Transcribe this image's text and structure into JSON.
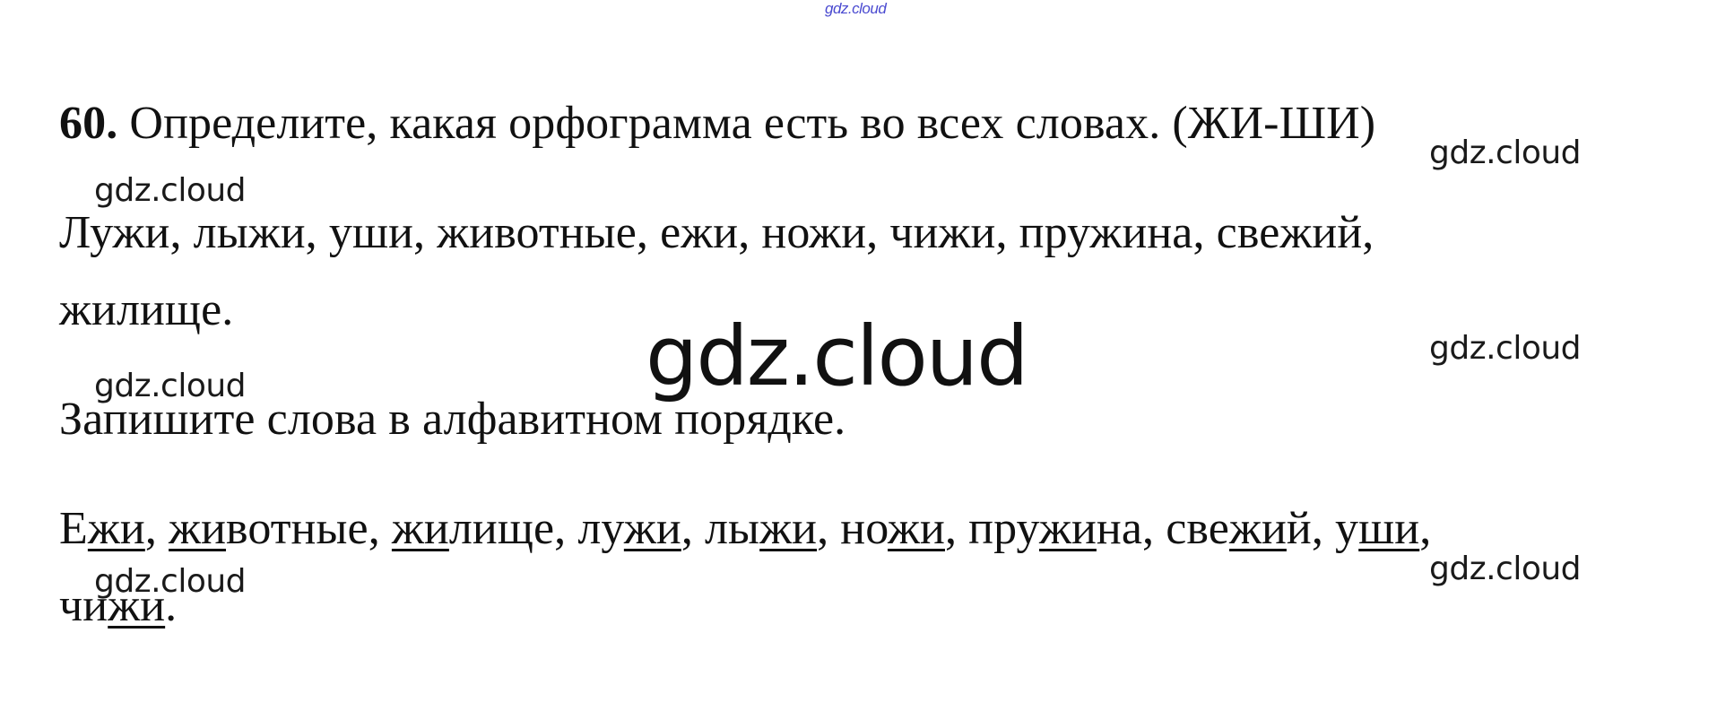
{
  "watermarks": {
    "top": "gdz.cloud",
    "big": "gdz.cloud",
    "small": "gdz.cloud"
  },
  "task": {
    "number": "60.",
    "instruction": " Определите, какая орфограмма есть во всех словах. (ЖИ-ШИ)",
    "words_line1": "Лужи, лыжи, уши, животные, ежи, ножи, чижи, пружина, свежий,",
    "words_line2": "жилище.",
    "subtask": "Запишите слова в алфавитном порядке."
  },
  "answer": {
    "segments": [
      {
        "t": "Е",
        "u": false
      },
      {
        "t": "жи",
        "u": true
      },
      {
        "t": ", ",
        "u": false
      },
      {
        "t": "жи",
        "u": true
      },
      {
        "t": "вотные, ",
        "u": false
      },
      {
        "t": "жи",
        "u": true
      },
      {
        "t": "лище, лу",
        "u": false
      },
      {
        "t": "жи",
        "u": true
      },
      {
        "t": ", лы",
        "u": false
      },
      {
        "t": "жи",
        "u": true
      },
      {
        "t": ", но",
        "u": false
      },
      {
        "t": "жи",
        "u": true
      },
      {
        "t": ", пру",
        "u": false
      },
      {
        "t": "жи",
        "u": true
      },
      {
        "t": "на, све",
        "u": false
      },
      {
        "t": "жи",
        "u": true
      },
      {
        "t": "й, у",
        "u": false
      },
      {
        "t": "ши",
        "u": true
      },
      {
        "t": ",",
        "u": false
      }
    ],
    "segments_line2": [
      {
        "t": "чи",
        "u": false
      },
      {
        "t": "жи",
        "u": true
      },
      {
        "t": ".",
        "u": false
      }
    ]
  }
}
